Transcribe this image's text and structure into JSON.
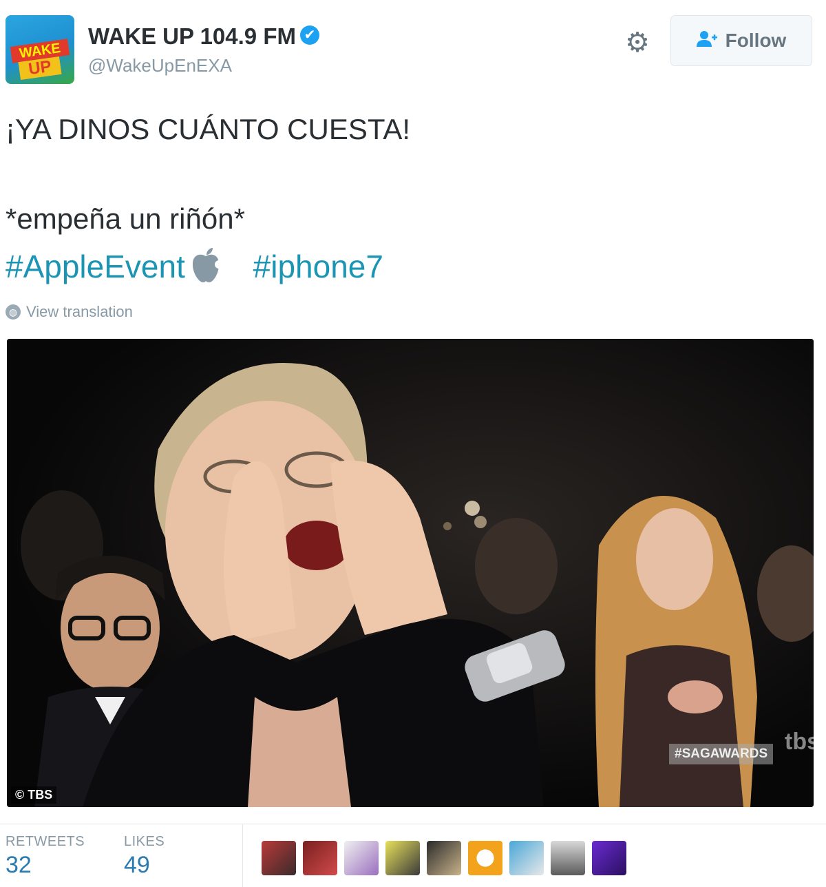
{
  "header": {
    "name": "WAKE UP 104.9 FM",
    "verified_glyph": "✔",
    "handle": "@WakeUpEnEXA",
    "follow_label": "Follow",
    "avatar_text_top": "WAKE",
    "avatar_text_bottom": "UP"
  },
  "tweet": {
    "line1": "¡YA DINOS CUÁNTO CUESTA!",
    "line2": "*empeña un riñón*",
    "hashtag1": "#AppleEvent",
    "hashtag2": "#iphone7",
    "view_translation": "View translation"
  },
  "media": {
    "watermark_left": "© TBS",
    "watermark_right": "#SAGAWARDS",
    "channel_logo": "tbs"
  },
  "stats": {
    "retweets_label": "RETWEETS",
    "retweets_count": "32",
    "likes_label": "LIKES",
    "likes_count": "49"
  },
  "icons": {
    "gear": "gear-icon",
    "follow": "add-user-icon",
    "verified": "verified-badge-icon",
    "globe": "globe-icon",
    "apple": "apple-logo-icon"
  },
  "colors": {
    "hashtag": "#1b95b3",
    "verified": "#1da1f2",
    "stat_value": "#2a7bb0",
    "muted": "#8899a6"
  }
}
